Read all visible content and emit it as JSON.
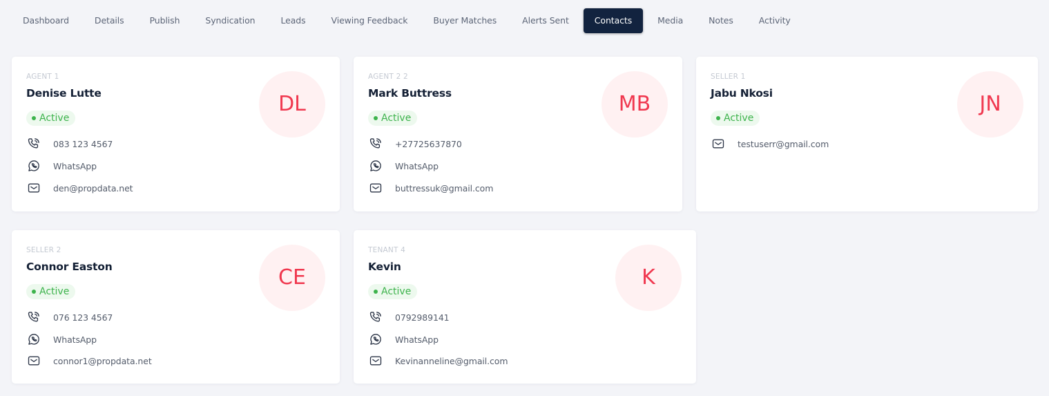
{
  "tabs": [
    {
      "label": "Dashboard",
      "active": false
    },
    {
      "label": "Details",
      "active": false
    },
    {
      "label": "Publish",
      "active": false
    },
    {
      "label": "Syndication",
      "active": false
    },
    {
      "label": "Leads",
      "active": false
    },
    {
      "label": "Viewing Feedback",
      "active": false
    },
    {
      "label": "Buyer Matches",
      "active": false
    },
    {
      "label": "Alerts Sent",
      "active": false
    },
    {
      "label": "Contacts",
      "active": true
    },
    {
      "label": "Media",
      "active": false
    },
    {
      "label": "Notes",
      "active": false
    },
    {
      "label": "Activity",
      "active": false
    }
  ],
  "contacts": [
    {
      "role": "AGENT 1",
      "name": "Denise Lutte",
      "status": "Active",
      "initials": "DL",
      "phone": "083 123 4567",
      "whatsapp": "WhatsApp",
      "email": "den@propdata.net"
    },
    {
      "role": "AGENT 2 2",
      "name": "Mark Buttress",
      "status": "Active",
      "initials": "MB",
      "phone": "+27725637870",
      "whatsapp": "WhatsApp",
      "email": "buttressuk@gmail.com"
    },
    {
      "role": "SELLER 1",
      "name": "Jabu Nkosi",
      "status": "Active",
      "initials": "JN",
      "email": "testuserr@gmail.com"
    },
    {
      "role": "SELLER 2",
      "name": "Connor Easton",
      "status": "Active",
      "initials": "CE",
      "phone": "076 123 4567",
      "whatsapp": "WhatsApp",
      "email": "connor1@propdata.net"
    },
    {
      "role": "TENANT 4",
      "name": "Kevin",
      "status": "Active",
      "initials": "K",
      "phone": "0792989141",
      "whatsapp": "WhatsApp",
      "email": "Kevinanneline@gmail.com"
    }
  ],
  "colors": {
    "accent_dark": "#12233f",
    "avatar_text": "#f0384f",
    "avatar_bg": "#fff1f2",
    "status_green": "#3db34c",
    "status_bg": "#edf9ee"
  },
  "icons": {
    "phone": "phone-icon",
    "whatsapp": "whatsapp-icon",
    "email": "mail-icon"
  }
}
